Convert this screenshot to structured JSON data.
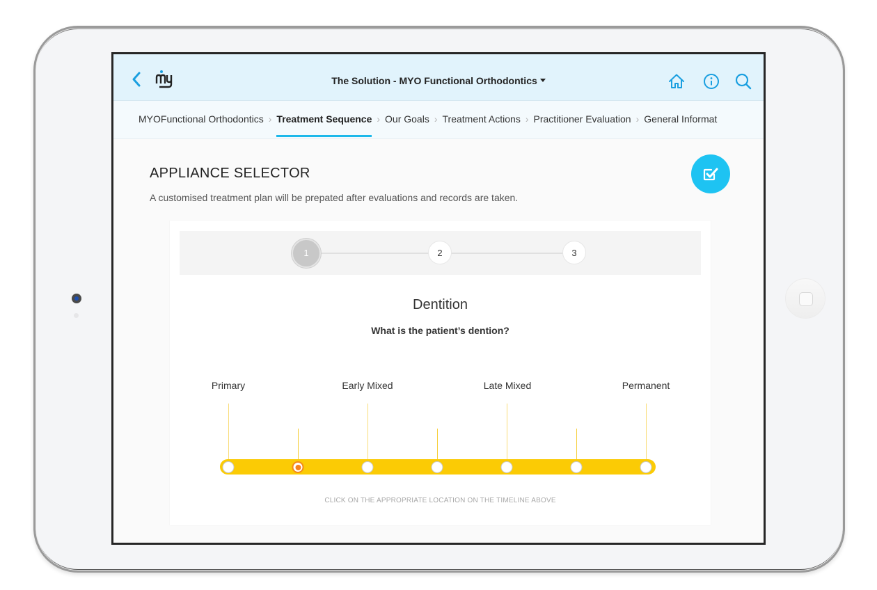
{
  "device": {
    "camera": "front-camera",
    "home_button": "home-button"
  },
  "header": {
    "back_icon": "chevron-left-icon",
    "logo_text": "my",
    "title": "The Solution  - MYO Functional Orthodontics",
    "title_dropdown_icon": "caret-down-icon",
    "actions": [
      {
        "name": "home",
        "icon": "home-icon"
      },
      {
        "name": "info",
        "icon": "info-icon"
      },
      {
        "name": "search",
        "icon": "search-icon"
      }
    ],
    "accent_color": "#1a9fe0",
    "background_color": "#e1f3fc"
  },
  "breadcrumb": {
    "items": [
      {
        "label": "MYOFunctional Orthodontics",
        "active": false
      },
      {
        "label": "Treatment Sequence",
        "active": true
      },
      {
        "label": "Our Goals",
        "active": false
      },
      {
        "label": "Treatment Actions",
        "active": false
      },
      {
        "label": "Practitioner Evaluation",
        "active": false
      },
      {
        "label": "General Informat",
        "active": false
      }
    ],
    "separator": "›",
    "active_underline_color": "#1fbcec"
  },
  "page": {
    "heading": "APPLIANCE SELECTOR",
    "subtext": "A customised treatment plan will be prepated after evaluations and records are taken.",
    "confirm_icon": "checkbox-checked-icon",
    "confirm_color": "#1ec3f2"
  },
  "stepper": {
    "steps": [
      {
        "label": "1",
        "active": true
      },
      {
        "label": "2",
        "active": false
      },
      {
        "label": "3",
        "active": false
      }
    ]
  },
  "question": {
    "title": "Dentition",
    "prompt": "What is the patient’s dention?",
    "timeline": {
      "labels": [
        "Primary",
        "Early Mixed",
        "Late Mixed",
        "Permanent"
      ],
      "node_count": 7,
      "selected_node_index": 1,
      "track_color": "#fbcb05",
      "selected_color": "#f58220"
    },
    "hint": "CLICK ON THE APPROPRIATE LOCATION ON THE TIMELINE ABOVE"
  }
}
